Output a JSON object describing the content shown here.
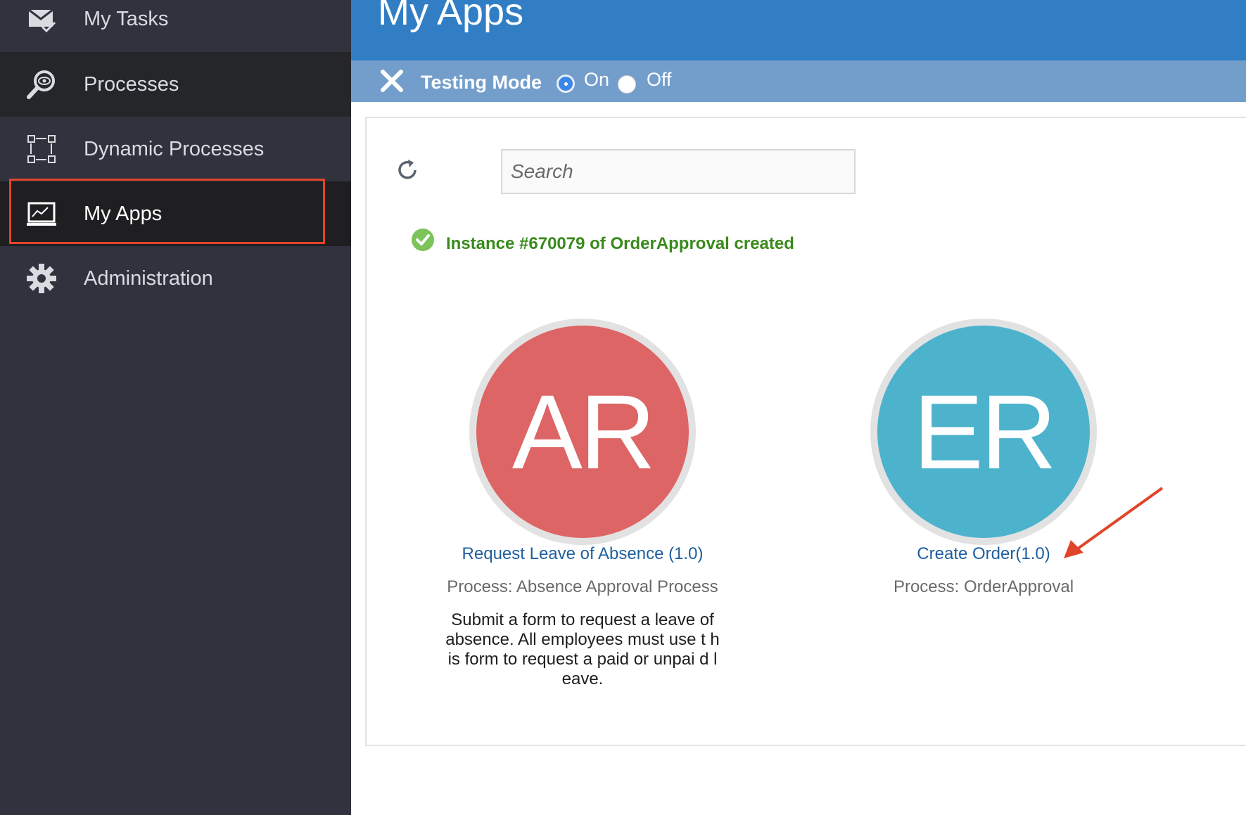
{
  "sidebar": {
    "items": [
      {
        "label": "My Tasks",
        "icon": "tasks-icon"
      },
      {
        "label": "Processes",
        "icon": "process-search-icon"
      },
      {
        "label": "Dynamic Processes",
        "icon": "dynamic-process-icon"
      },
      {
        "label": "My Apps",
        "icon": "monitor-chart-icon",
        "selected": true
      },
      {
        "label": "Administration",
        "icon": "gear-icon"
      }
    ]
  },
  "header": {
    "title": "My Apps"
  },
  "testing_mode": {
    "label": "Testing Mode",
    "on_label": "On",
    "off_label": "Off",
    "selected": "On"
  },
  "search": {
    "placeholder": "Search",
    "value": ""
  },
  "status": {
    "message": "Instance #670079 of OrderApproval created",
    "color": "#3a8a1c"
  },
  "apps": [
    {
      "initials": "AR",
      "name": "Request Leave of Absence (1.0)",
      "process": "Process: Absence Approval Process",
      "description": "Submit a form to request a leave of absence. All employees must use t his form to request a paid or unpai d leave.",
      "color": "#dd6565"
    },
    {
      "initials": "ER",
      "name": "Create Order(1.0)",
      "process": "Process: OrderApproval",
      "description": "",
      "color": "#4db3cd"
    }
  ],
  "colors": {
    "sidebar_bg": "#30323e",
    "header_bg": "#327ec4",
    "testing_bar_bg": "#739ecb",
    "highlight": "#e0452b"
  }
}
